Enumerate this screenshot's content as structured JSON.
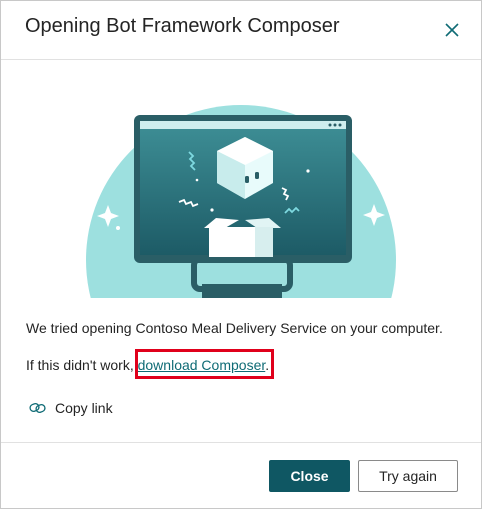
{
  "dialog": {
    "title": "Opening Bot Framework Composer",
    "message": "We tried opening Contoso Meal Delivery Service on your computer.",
    "fallback_prefix": "If this didn't work, ",
    "fallback_link": "download Composer",
    "fallback_suffix": ".",
    "copy_link_label": "Copy link",
    "close_button": "Close",
    "retry_button": "Try again",
    "icons": {
      "close": "close-icon",
      "copy": "link-icon"
    },
    "colors": {
      "accent": "#0f5763",
      "link": "#0f6b75",
      "highlight": "#e0001b",
      "illustration_bg": "#9de0df"
    }
  }
}
